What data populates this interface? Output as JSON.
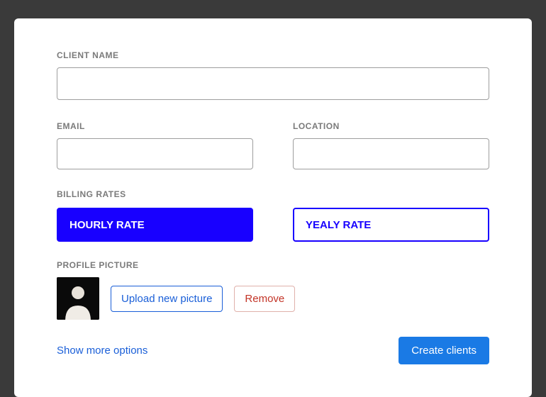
{
  "clientName": {
    "label": "CLIENT NAME",
    "value": ""
  },
  "email": {
    "label": "EMAIL",
    "value": ""
  },
  "location": {
    "label": "LOCATION",
    "value": ""
  },
  "billing": {
    "label": "BILLING RATES",
    "hourly": "HOURLY RATE",
    "yearly": "YEALY RATE"
  },
  "profile": {
    "label": "PROFILE PICTURE",
    "uploadLabel": "Upload new picture",
    "removeLabel": "Remove"
  },
  "moreOptionsLabel": "Show more options",
  "createLabel": "Create clients"
}
